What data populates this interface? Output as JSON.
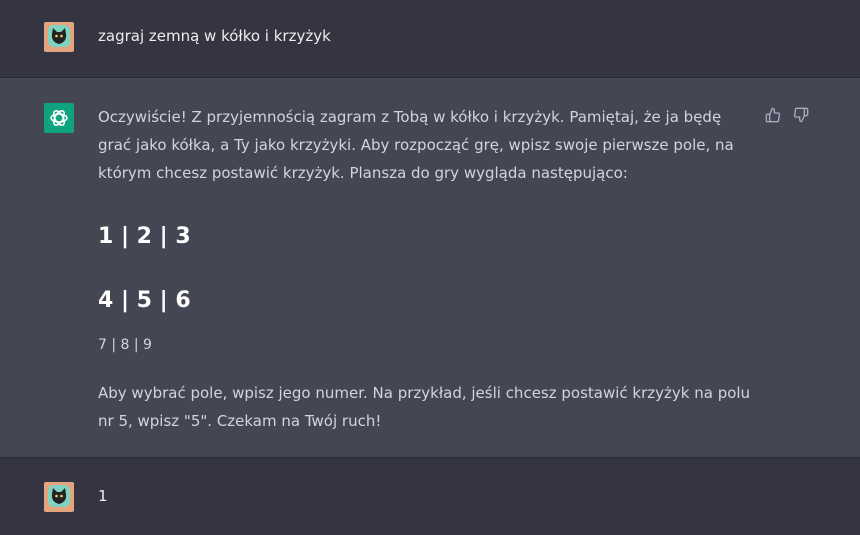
{
  "messages": {
    "user_prompt": "zagraj zemną w kółko i krzyżyk",
    "assistant_intro": "Oczywiście! Z przyjemnością zagram z Tobą w kółko i krzyżyk. Pamiętaj, że ja będę grać jako kółka, a Ty jako krzyżyki. Aby rozpocząć grę, wpisz swoje pierwsze pole, na którym chcesz postawić krzyżyk. Plansza do gry wygląda następująco:",
    "board_row_1": "1 | 2 | 3",
    "board_row_2": "4 | 5 | 6",
    "board_row_3": "7 | 8 | 9",
    "assistant_outro": "Aby wybrać pole, wpisz jego numer. Na przykład, jeśli chcesz postawić krzyżyk na polu nr 5, wpisz \"5\". Czekam na Twój ruch!",
    "user_reply": "1"
  },
  "icons": {
    "user_avatar": "cat-avatar-icon",
    "assistant_avatar": "openai-logo-icon",
    "like": "thumbs-up-icon",
    "dislike": "thumbs-down-icon"
  },
  "colors": {
    "user_row_bg": "#343541",
    "assistant_row_bg": "#444654",
    "assistant_avatar_bg": "#10a37f",
    "user_avatar_bg": "#e2a57f"
  }
}
